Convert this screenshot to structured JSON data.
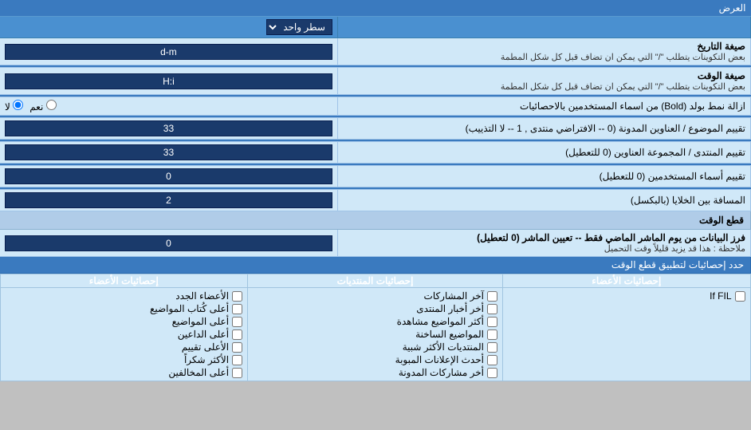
{
  "title": "العرض",
  "dropdown_label": "سطر واحد",
  "date_format_label": "صيغة التاريخ",
  "date_format_desc": "بعض التكوينات يتطلب \"/\" التي يمكن ان تضاف قبل كل شكل المطمة",
  "date_format_value": "d-m",
  "time_format_label": "صيغة الوقت",
  "time_format_desc": "بعض التكوينات يتطلب \"/\" التي يمكن ان تضاف قبل كل شكل المطمة",
  "time_format_value": "H:i",
  "bold_label": "ازالة نمط بولد (Bold) من اسماء المستخدمين بالاحصائيات",
  "bold_yes": "نعم",
  "bold_no": "لا",
  "topics_order_label": "تقييم الموضوع / العناوين المدونة (0 -- الافتراضي منتدى , 1 -- لا التذييب)",
  "topics_order_value": "33",
  "forum_order_label": "تقييم المنتدى / المجموعة العناوين (0 للتعطيل)",
  "forum_order_value": "33",
  "usernames_label": "تقييم أسماء المستخدمين (0 للتعطيل)",
  "usernames_value": "0",
  "cell_distance_label": "المسافة بين الخلايا (بالبكسل)",
  "cell_distance_value": "2",
  "realtime_section": "قطع الوقت",
  "realtime_filter_label": "فرز البيانات من يوم الماشر الماضي فقط -- تعيين الماشر (0 لتعطيل)",
  "realtime_filter_note": "ملاحظة : هذا قد يزيد قليلاً وقت التحميل",
  "realtime_filter_value": "0",
  "stats_apply_label": "حدد إحصائيات لتطبيق قطع الوقت",
  "stats_cols": [
    {
      "header": "إحصائيات الأعضاء",
      "items": [
        "الأعضاء الجدد",
        "أعلى كُتاب المواضيع",
        "أعلى المواضيع",
        "أعلى الداعين",
        "الأعلى تقييم",
        "الأكثر شكراً",
        "أعلى المخالفين"
      ]
    },
    {
      "header": "إحصائيات المنتديات",
      "items": [
        "آخر المشاركات",
        "أخر أخبار المنتدى",
        "أكثر المواضيع مشاهدة",
        "المواضيع الساخنة",
        "المنتديات الأكثر شبية",
        "أحدث الإعلانات المبوبة",
        "أخر مشاركات المدونة"
      ]
    },
    {
      "header": "إحصائيات الأعضاء",
      "items": [
        "If FIL"
      ]
    }
  ]
}
